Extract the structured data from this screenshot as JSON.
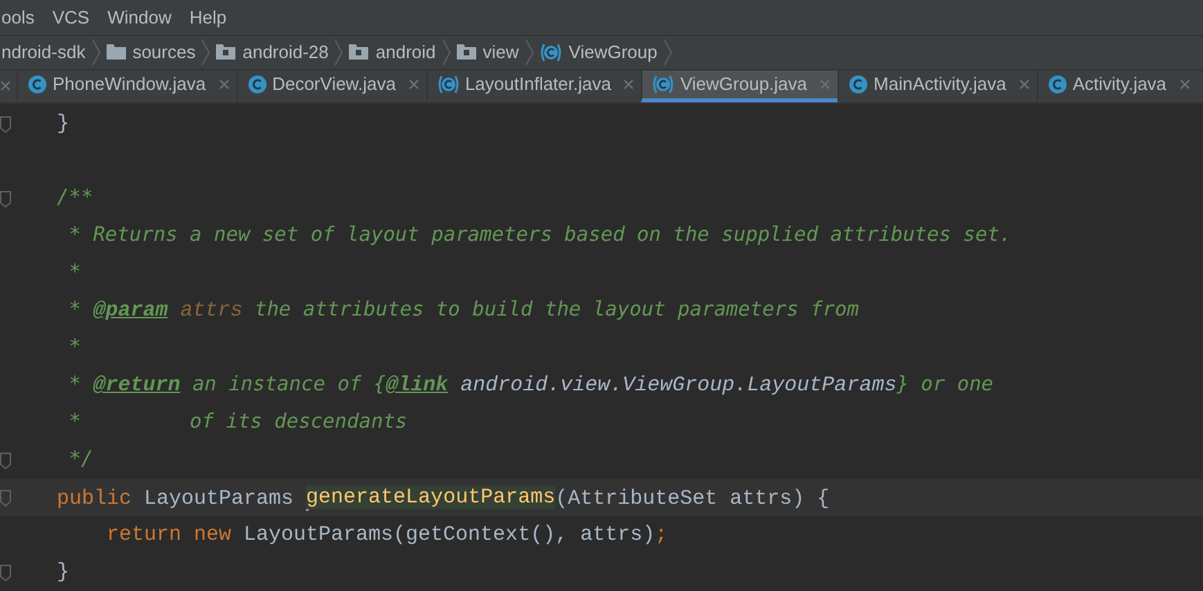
{
  "menu": [
    "ools",
    "VCS",
    "Window",
    "Help"
  ],
  "breadcrumbs": [
    {
      "label": "ndroid-sdk",
      "kind": "none"
    },
    {
      "label": "sources",
      "kind": "folder"
    },
    {
      "label": "android-28",
      "kind": "package"
    },
    {
      "label": "android",
      "kind": "package"
    },
    {
      "label": "view",
      "kind": "package"
    },
    {
      "label": "ViewGroup",
      "kind": "class"
    }
  ],
  "tabs": [
    {
      "label": "PhoneWindow.java",
      "kind": "class",
      "selected": false
    },
    {
      "label": "DecorView.java",
      "kind": "class",
      "selected": false
    },
    {
      "label": "LayoutInflater.java",
      "kind": "class-readonly",
      "selected": false
    },
    {
      "label": "ViewGroup.java",
      "kind": "class-readonly",
      "selected": true
    },
    {
      "label": "MainActivity.java",
      "kind": "class",
      "selected": false
    },
    {
      "label": "Activity.java",
      "kind": "class",
      "selected": false
    }
  ],
  "code_lines": [
    {
      "kind": "fold",
      "tokens": [
        {
          "text": "}",
          "kind": "plain"
        }
      ]
    },
    {
      "kind": "blank"
    },
    {
      "kind": "fold",
      "tokens": [
        {
          "text": "/**",
          "kind": "comment"
        }
      ]
    },
    {
      "kind": "plain",
      "tokens": [
        {
          "text": " * Returns a new set of layout parameters based on the supplied attributes set.",
          "kind": "comment"
        }
      ]
    },
    {
      "kind": "plain",
      "tokens": [
        {
          "text": " *",
          "kind": "comment"
        }
      ]
    },
    {
      "kind": "plain",
      "tokens": [
        {
          "text": " * ",
          "kind": "comment"
        },
        {
          "text": "@param",
          "kind": "doctag"
        },
        {
          "text": " attrs",
          "kind": "docparam"
        },
        {
          "text": " the attributes to build the layout parameters from",
          "kind": "comment"
        }
      ]
    },
    {
      "kind": "plain",
      "tokens": [
        {
          "text": " *",
          "kind": "comment"
        }
      ]
    },
    {
      "kind": "plain",
      "tokens": [
        {
          "text": " * ",
          "kind": "comment"
        },
        {
          "text": "@return",
          "kind": "doctag"
        },
        {
          "text": " an instance of {",
          "kind": "comment"
        },
        {
          "text": "@link",
          "kind": "doctag"
        },
        {
          "text": " android.view.ViewGroup.LayoutParams",
          "kind": "doclink"
        },
        {
          "text": "} or one",
          "kind": "comment"
        }
      ]
    },
    {
      "kind": "plain",
      "tokens": [
        {
          "text": " *         of its descendants",
          "kind": "comment"
        }
      ]
    },
    {
      "kind": "fold",
      "tokens": [
        {
          "text": " */",
          "kind": "comment"
        }
      ]
    },
    {
      "kind": "caret",
      "tokens": [
        {
          "text": "public ",
          "kind": "keyword"
        },
        {
          "text": "LayoutParams ",
          "kind": "plain"
        },
        {
          "text": "generateLayoutParams",
          "kind": "method-caret"
        },
        {
          "text": "(AttributeSet attrs) {",
          "kind": "plain"
        }
      ]
    },
    {
      "kind": "plain",
      "tokens": [
        {
          "text": "    return new ",
          "kind": "keyword"
        },
        {
          "text": "LayoutParams(getContext(), attrs)",
          "kind": "plain"
        },
        {
          "text": ";",
          "kind": "keyword"
        }
      ]
    },
    {
      "kind": "fold",
      "tokens": [
        {
          "text": "}",
          "kind": "plain"
        }
      ]
    }
  ]
}
